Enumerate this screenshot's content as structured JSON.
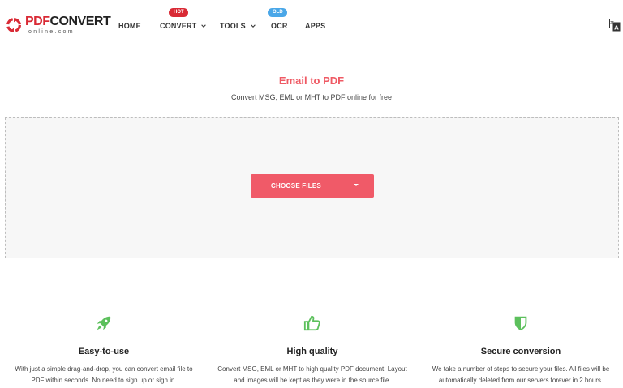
{
  "header": {
    "logo": {
      "pdf": "PDF",
      "convert": "CONVERT",
      "sub": "online.com"
    },
    "nav": [
      {
        "label": "HOME"
      },
      {
        "label": "CONVERT",
        "badge": "HOT",
        "dropdown": true
      },
      {
        "label": "TOOLS",
        "dropdown": true
      },
      {
        "label": "OCR",
        "badge": "OLD"
      },
      {
        "label": "APPS"
      }
    ],
    "language_icon": "translate-icon"
  },
  "main": {
    "title": "Email to PDF",
    "subtitle": "Convert MSG, EML or MHT to PDF online for free",
    "choose_button": "CHOOSE FILES"
  },
  "features": [
    {
      "icon": "rocket-icon",
      "title": "Easy-to-use",
      "line1": "With just a simple drag-and-drop, you can convert email file to",
      "line2": "PDF within seconds. No need to sign up or sign in."
    },
    {
      "icon": "thumbs-up-icon",
      "title": "High quality",
      "line1": "Convert MSG, EML or MHT to high quality PDF document. Layout",
      "line2": "and images will be kept as they were in the source file."
    },
    {
      "icon": "shield-icon",
      "title": "Secure conversion",
      "line1": "We take a number of steps to secure your files. All files will be",
      "line2": "automatically deleted from our servers forever in 2 hours."
    }
  ],
  "colors": {
    "accent": "#f05a68",
    "title": "#ef5a64",
    "feature_icon": "#5cc05c",
    "badge_hot": "#d92a35",
    "badge_old": "#4aa7e8"
  }
}
